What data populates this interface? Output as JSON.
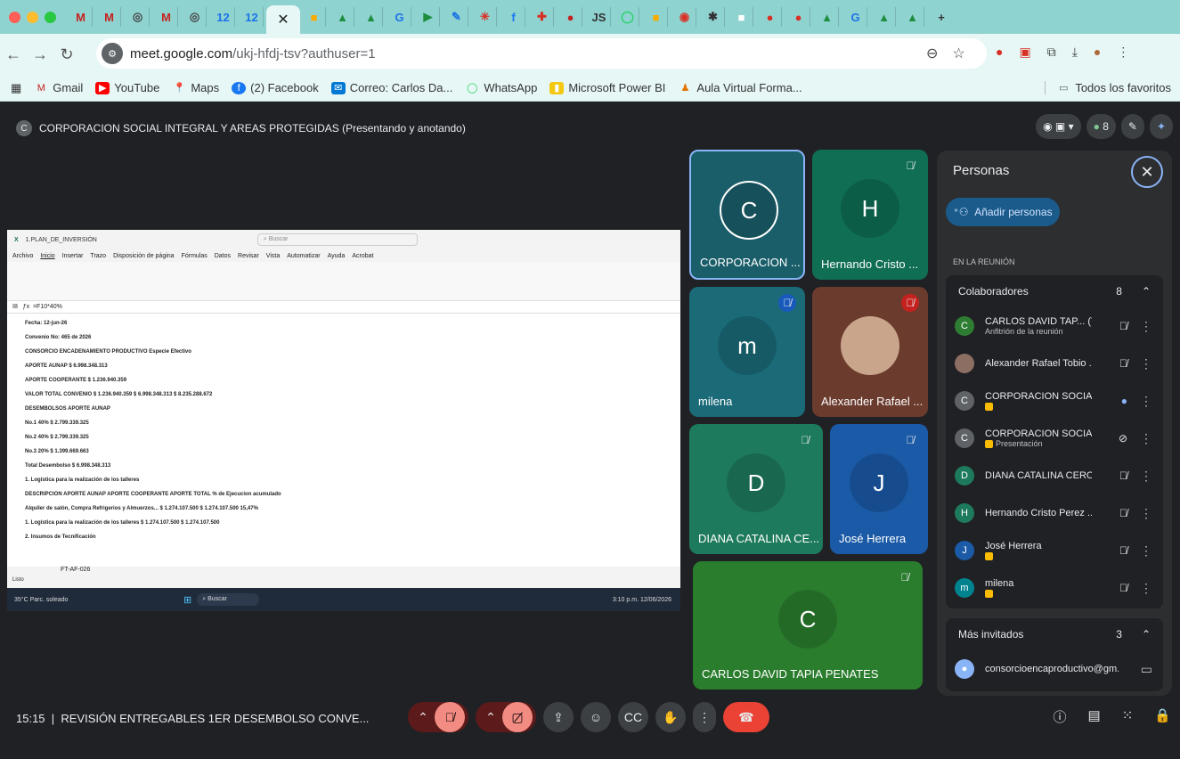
{
  "browser": {
    "url_host": "meet.google.com",
    "url_path": "/ukj-hfdj-tsv?authuser=1",
    "bookmarks": [
      "Gmail",
      "YouTube",
      "Maps",
      "(2) Facebook",
      "Correo: Carlos Da...",
      "WhatsApp",
      "Microsoft Power BI",
      "Aula Virtual Forma..."
    ],
    "all_bookmarks": "Todos los favoritos",
    "tab_letters": [
      "M",
      "M",
      "M",
      "M",
      "12",
      "12",
      "×",
      "A",
      "A",
      "G",
      "+",
      "J",
      "S"
    ]
  },
  "meet": {
    "presentation_title": "CORPORACION SOCIAL INTEGRAL Y AREAS PROTEGIDAS (Presentando y anotando)",
    "presenter_initial": "C",
    "participant_count_badge": "8",
    "meeting_time": "15:15",
    "meeting_name": "REVISIÓN ENTREGABLES 1ER DESEMBOLSO CONVE..."
  },
  "shared_screen": {
    "window_title": "1.PLAN_DE_INVERSIÓN",
    "search_placeholder": "Buscar",
    "menu": [
      "Archivo",
      "Inicio",
      "Insertar",
      "Trazo",
      "Disposición de página",
      "Fórmulas",
      "Datos",
      "Revisar",
      "Vista",
      "Automatizar",
      "Ayuda",
      "Acrobat"
    ],
    "formula": "=F10*40%",
    "rows": [
      "Fecha: 12-jun-26",
      "Convenio No: 465 de 2026",
      "CONSORCIO ENCADENAMIENTO PRODUCTIVO   Especie   Efectivo",
      "APORTE AUNAP   $ 6.998.348.313",
      "APORTE COOPERANTE   $ 1.236.940.359",
      "VALOR TOTAL CONVENIO   $ 1.236.940.359   $ 6.998.348.313   $ 8.235.288.672",
      "DESEMBOLSOS APORTE AUNAP",
      "No.1 40%   $ 2.799.339.325",
      "No.2 40%   $ 2.799.339.325",
      "No.3 20%   $ 1.399.669.663",
      "Total Desembolso   $ 6.998.348.313",
      "1. Logística para la realización de los talleres",
      "DESCRIPCION   APORTE AUNAP   APORTE COOPERANTE   APORTE TOTAL   % de Ejecucion acumulado",
      "Alquiler de salón, Compra Refrigerios y Almuerzos...   $ 1.274.107.500   $ 1.274.107.500   15,47%",
      "1. Logística para la realización de los talleres   $ 1.274.107.500   $ 1.274.107.500",
      "2. Insumos de Tecnificación"
    ],
    "sheet_tab": "FT-AF-026",
    "status": "Listo",
    "taskbar_weather": "35°C Parc. soleado",
    "taskbar_search": "Buscar",
    "taskbar_time": "3:10 p.m. 12/06/2026"
  },
  "tiles": [
    {
      "initial": "C",
      "name": "CORPORACION ...",
      "color": "#1a5e6a"
    },
    {
      "initial": "H",
      "name": "Hernando Cristo ...",
      "color": "#0f6e54"
    },
    {
      "initial": "m",
      "name": "milena",
      "color": "#1a6a78"
    },
    {
      "initial": "",
      "name": "Alexander Rafael ...",
      "color": "#6b3b2e"
    },
    {
      "initial": "D",
      "name": "DIANA CATALINA CE...",
      "color": "#1e7a5c"
    },
    {
      "initial": "J",
      "name": "José Herrera",
      "color": "#1b5aa6"
    },
    {
      "initial": "C",
      "name": "CARLOS DAVID TAPIA PENATES",
      "color": "#2b7d2e"
    }
  ],
  "panel": {
    "title": "Personas",
    "add_people": "Añadir personas",
    "section": "EN LA REUNIÓN",
    "collaborators_label": "Colaboradores",
    "collaborators_count": "8",
    "people": [
      {
        "initial": "C",
        "name": "CARLOS DAVID TAP... (Tú)",
        "sub": "Anfitrión de la reunión",
        "color": "#2e7d32"
      },
      {
        "initial": "",
        "name": "Alexander Rafael Tobio ...",
        "sub": "",
        "color": "#8d6e63"
      },
      {
        "initial": "C",
        "name": "CORPORACION SOCIA...",
        "sub": "",
        "color": "#5f6368"
      },
      {
        "initial": "C",
        "name": "CORPORACION SOCIA...",
        "sub": "Presentación",
        "color": "#5f6368"
      },
      {
        "initial": "D",
        "name": "DIANA CATALINA CERO...",
        "sub": "",
        "color": "#1e7a5c"
      },
      {
        "initial": "H",
        "name": "Hernando Cristo Perez ...",
        "sub": "",
        "color": "#1e7a5c"
      },
      {
        "initial": "J",
        "name": "José Herrera",
        "sub": "",
        "color": "#1b5aa6"
      },
      {
        "initial": "m",
        "name": "milena",
        "sub": "",
        "color": "#00838f"
      }
    ],
    "more_guests_label": "Más invitados",
    "more_guests_count": "3",
    "guest": "consorcioencaproductivo@gm..."
  }
}
